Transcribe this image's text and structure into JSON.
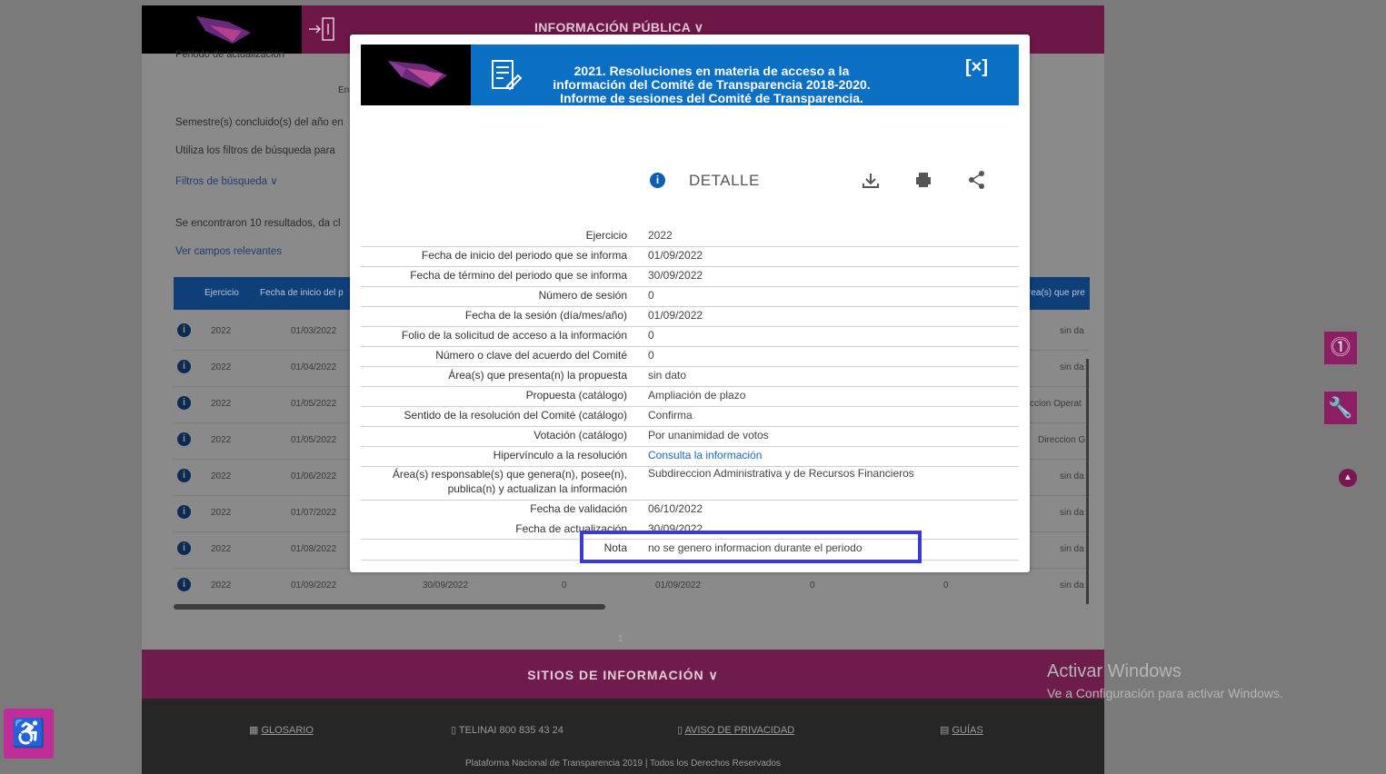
{
  "topbar": {
    "nav_title": "INFORMACIÓN PÚBLICA ∨",
    "login_glyph": "→⃞"
  },
  "background": {
    "periodo_label": "Periodo de actualización",
    "en_text": "En",
    "semestre_text": "Semestre(s) concluido(s) del año en",
    "utiliza_text": "Utiliza los filtros de búsqueda para",
    "filtros_link": "Filtros de búsqueda ∨",
    "resultados_text": "Se encontraron 10 resultados, da cl",
    "ver_campos_link": "Ver campos relevantes",
    "table_headers": {
      "ejercicio": "Ejercicio",
      "fecha_inicio": "Fecha de inicio del p",
      "areas": "rea(s) que pre"
    },
    "rows": [
      {
        "ejercicio": "2022",
        "fecha": "01/03/2022",
        "right": "sin da"
      },
      {
        "ejercicio": "2022",
        "fecha": "01/04/2022",
        "right": "sin da"
      },
      {
        "ejercicio": "2022",
        "fecha": "01/05/2022",
        "right": "ccion Operat"
      },
      {
        "ejercicio": "2022",
        "fecha": "01/05/2022",
        "right": "Direccion G"
      },
      {
        "ejercicio": "2022",
        "fecha": "01/06/2022",
        "right": "sin da"
      },
      {
        "ejercicio": "2022",
        "fecha": "01/07/2022",
        "right": "sin da"
      },
      {
        "ejercicio": "2022",
        "fecha": "01/08/2022",
        "right": "sin da"
      },
      {
        "ejercicio": "2022",
        "fecha": "01/09/2022",
        "right": "sin da",
        "termino": "30/09/2022",
        "num": "0",
        "fecha_sesion": "01/09/2022",
        "folio": "0",
        "acuerdo": "0"
      }
    ],
    "pager": "1"
  },
  "sitios": {
    "label": "SITIOS DE INFORMACIÓN ∨"
  },
  "footer": {
    "glosario": "GLOSARIO",
    "telinai": "TELINAI 800 835 43 24",
    "aviso": "AVISO DE PRIVACIDAD",
    "guias": "GUÍAS",
    "copyright": "Plataforma Nacional de Transparencia 2019 | Todos los Derechos Reservados"
  },
  "watermark": {
    "line1": "Activar Windows",
    "line2": "Ve a Configuración para activar Windows."
  },
  "modal": {
    "title": "2021. Resoluciones en materia de acceso a la información del Comité de Transparencia 2018-2020. Informe de sesiones del Comité de Transparencia.",
    "close_label": "[×]",
    "detail_label": "DETALLE",
    "fields": [
      {
        "k": "Ejercicio",
        "v": "2022"
      },
      {
        "k": "Fecha de inicio del periodo que se informa",
        "v": "01/09/2022"
      },
      {
        "k": "Fecha de término del periodo que se informa",
        "v": "30/09/2022"
      },
      {
        "k": "Número de sesión",
        "v": "0"
      },
      {
        "k": "Fecha de la sesión (día/mes/año)",
        "v": "01/09/2022"
      },
      {
        "k": "Folio de la solicitud de acceso a la información",
        "v": "0"
      },
      {
        "k": "Número o clave del acuerdo del Comité",
        "v": "0"
      },
      {
        "k": "Área(s) que presenta(n) la propuesta",
        "v": "sin dato"
      },
      {
        "k": "Propuesta (catálogo)",
        "v": "Ampliación de plazo"
      },
      {
        "k": "Sentido de la resolución del Comité (catálogo)",
        "v": "Confirma"
      },
      {
        "k": "Votación (catálogo)",
        "v": "Por unanimidad de votos"
      },
      {
        "k": "Hipervínculo a la resolución",
        "v": "Consulta la información"
      },
      {
        "k": "Área(s) responsable(s) que genera(n), posee(n), publica(n) y actualizan la información",
        "v": "Subdireccion Administrativa y de Recursos Financieros"
      },
      {
        "k": "Fecha de validación",
        "v": "06/10/2022"
      },
      {
        "k": "Fecha de actualización",
        "v": "30/09/2022"
      },
      {
        "k": "Nota",
        "v": "no se genero informacion durante el periodo"
      }
    ]
  }
}
